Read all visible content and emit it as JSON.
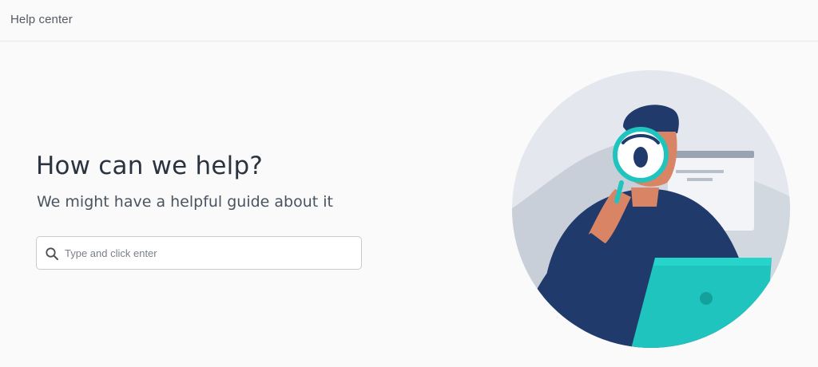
{
  "header": {
    "title": "Help center"
  },
  "hero": {
    "title": "How can we help?",
    "subtitle": "We might have a helpful guide about it"
  },
  "search": {
    "placeholder": "Type and click enter",
    "value": "",
    "icon": "search-icon"
  },
  "illustration": {
    "icons": [
      "person-icon",
      "magnifying-glass-icon",
      "laptop-icon",
      "browser-window-icon"
    ]
  },
  "colors": {
    "background": "#fafafa",
    "heading": "#2a3340",
    "accent_teal": "#1ec4bd",
    "navy": "#1f3a6b",
    "skin": "#d98565",
    "circle_bg": "#e4e8ee"
  }
}
